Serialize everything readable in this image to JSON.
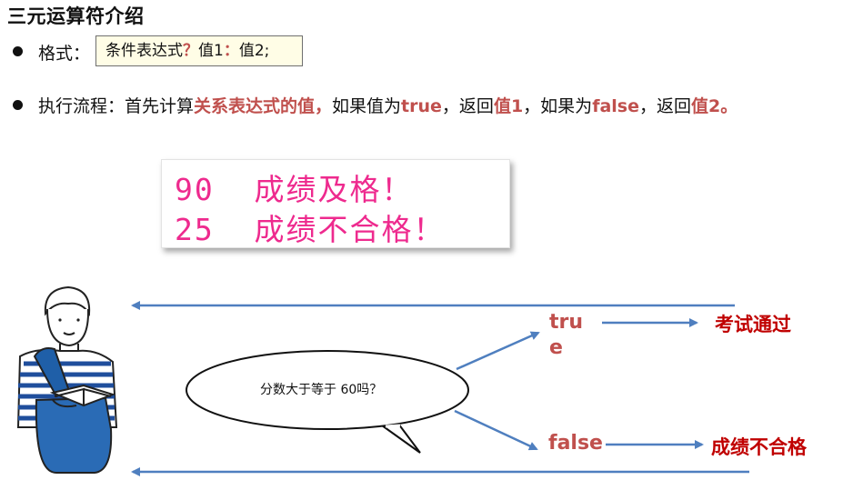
{
  "title": "三元运算符介绍",
  "format": {
    "label": "格式：",
    "expr_part1": "条件表达式",
    "q_mark": "？",
    "expr_part2": "值1",
    "colon": "：",
    "expr_part3": "值2;"
  },
  "process": {
    "label": "执行流程：首先计算",
    "h1": "关系表达式的值，",
    "t1": "如果值为",
    "h2": "true",
    "t2": "，返回",
    "h3": "值1",
    "t3": "，如果为",
    "h4": "false",
    "t4": "，返回",
    "h5": "值2。"
  },
  "output": {
    "line1": "90  成绩及格！",
    "line2": "25  成绩不合格！"
  },
  "diagram": {
    "question": "分数大于等于 60吗？",
    "true_label_1": "tru",
    "true_label_2": "e",
    "false_label": "false",
    "true_result": "考试通过",
    "false_result": "成绩不合格"
  },
  "colors": {
    "highlight": "#c0504d",
    "result": "#c00000",
    "arrow": "#4f7fbf",
    "output_text": "#ee2a8e"
  }
}
